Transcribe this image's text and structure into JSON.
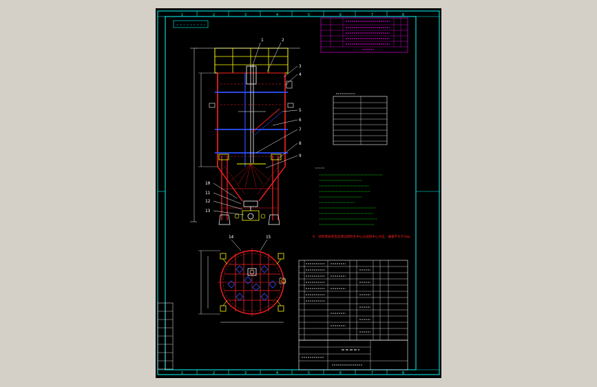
{
  "colors": {
    "background": "#d4d0c8",
    "paper": "#000000",
    "frame": "#00ffff",
    "white": "#ffffff",
    "red": "#ff2020",
    "yellow": "#ffff00",
    "blue": "#3050ff",
    "magenta": "#ff00ff",
    "green": "#00ff00"
  },
  "frame": {
    "top_marks": [
      "1",
      "2",
      "3",
      "4",
      "5",
      "6",
      "7",
      "8"
    ],
    "bottom_marks": [
      "1",
      "2",
      "3",
      "4",
      "5",
      "6",
      "7",
      "8"
    ]
  },
  "part_callouts": [
    "1",
    "2",
    "3",
    "4",
    "5",
    "6",
    "7",
    "8",
    "9",
    "10",
    "11",
    "12",
    "13",
    "14",
    "15"
  ],
  "red_note": "8. 喷吹管安装后应保证喷吹孔中心与滤袋中心对正，偏差不大于2mm。",
  "icons": {
    "elevation_view": "silo-elevation-drawing",
    "plan_view": "silo-plan-drawing"
  }
}
